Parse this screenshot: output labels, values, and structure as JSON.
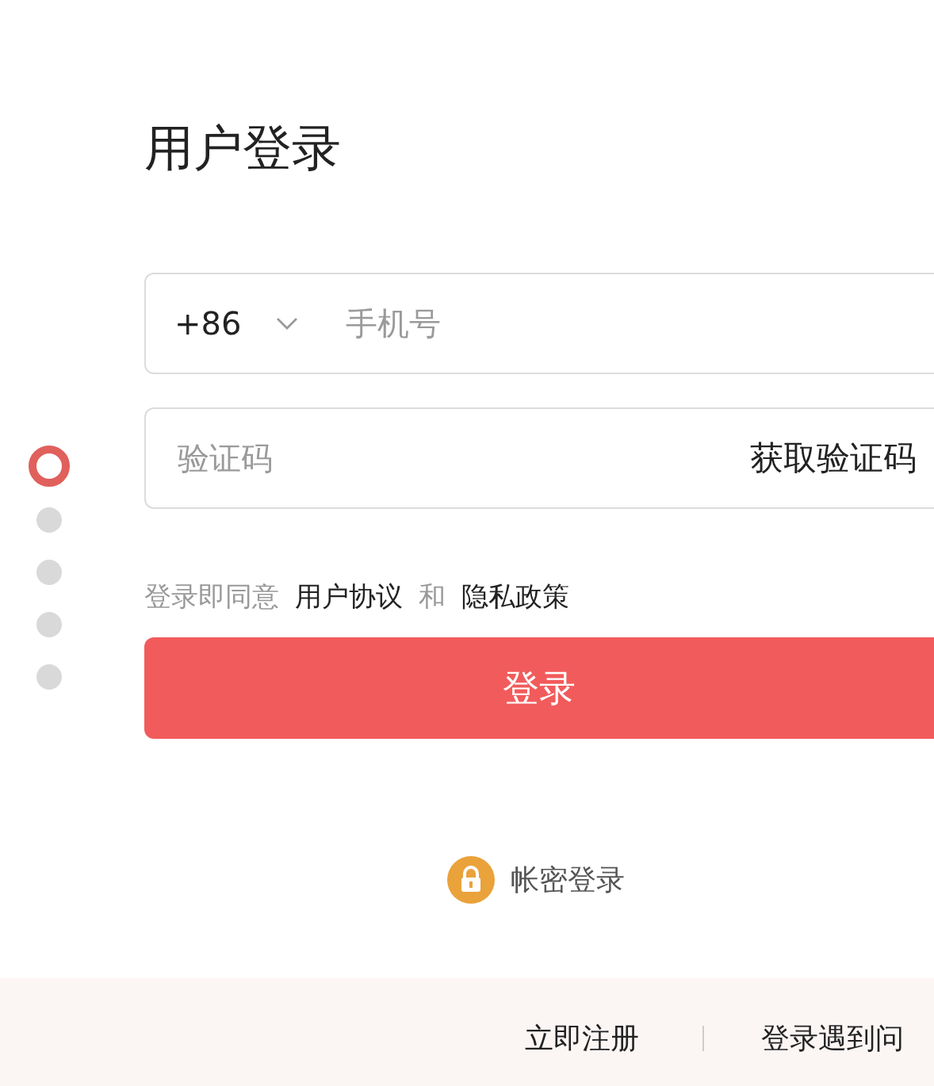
{
  "title": "用户登录",
  "steps": [
    {
      "selected": true
    },
    {
      "selected": false
    },
    {
      "selected": false
    },
    {
      "selected": false
    },
    {
      "selected": false
    }
  ],
  "phone": {
    "country_code": "+86",
    "placeholder": "手机号"
  },
  "code": {
    "placeholder": "验证码",
    "action": "获取验证码"
  },
  "agreement": {
    "prefix": "登录即同意",
    "link1": "用户协议",
    "joiner": "和",
    "link2": "隐私政策"
  },
  "login_button": "登录",
  "alt_login": "帐密登录",
  "footer": {
    "register": "立即注册",
    "help": "登录遇到问"
  }
}
